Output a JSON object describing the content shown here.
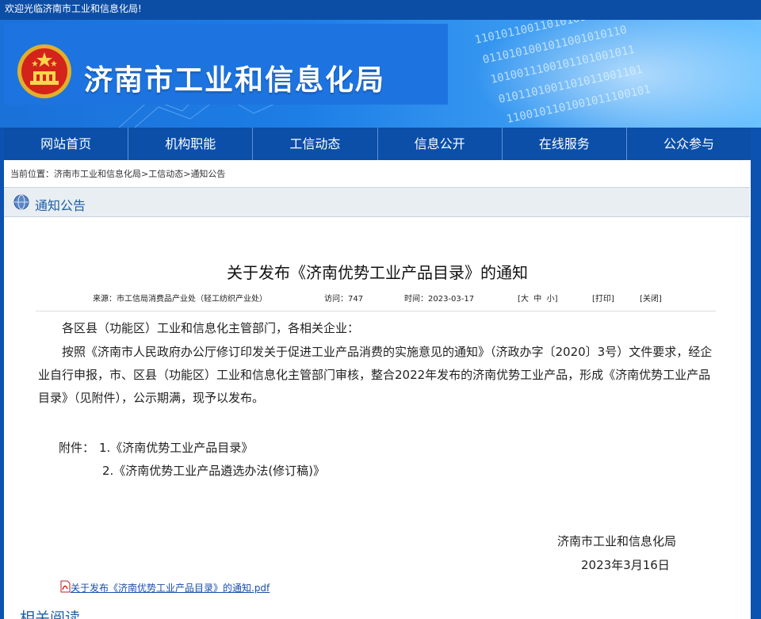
{
  "topbar": {
    "welcome": "欢迎光临济南市工业和信息化局!"
  },
  "header": {
    "site_title": "济南市工业和信息化局"
  },
  "nav": [
    {
      "label": "网站首页"
    },
    {
      "label": "机构职能"
    },
    {
      "label": "工信动态"
    },
    {
      "label": "信息公开"
    },
    {
      "label": "在线服务"
    },
    {
      "label": "公众参与"
    }
  ],
  "breadcrumb": {
    "prefix": "当前位置：",
    "items": [
      "济南市工业和信息化局",
      "工信动态",
      "通知公告"
    ],
    "separator": ">"
  },
  "section": {
    "title": "通知公告"
  },
  "article": {
    "title": "关于发布《济南优势工业产品目录》的通知",
    "meta": {
      "source": "来源：市工信局消费品产业处（轻工纺织产业处）",
      "visits": "访问：747",
      "date": "时间：2023-03-17",
      "font_size": "[大  中  小]",
      "print": "[打印]",
      "close": "[关闭]"
    },
    "greeting": "各区县（功能区）工业和信息化主管部门，各相关企业：",
    "body": "按照《济南市人民政府办公厅修订印发关于促进工业产品消费的实施意见的通知》（济政办字〔2020〕3号）文件要求，经企业自行申报，市、区县（功能区）工业和信息化主管部门审核，整合2022年发布的济南优势工业产品，形成《济南优势工业产品目录》（见附件），公示期满，现予以发布。",
    "attach_label": "附件：",
    "attachments": [
      "1.《济南优势工业产品目录》",
      "2.《济南优势工业产品遴选办法(修订稿)》"
    ],
    "signature": "济南市工业和信息化局",
    "sign_date": "2023年3月16日",
    "pdf_link": "关于发布《济南优势工业产品目录》的通知.pdf"
  },
  "related": {
    "title": "相关阅读"
  },
  "colors": {
    "nav_bg": "#0b4fa9",
    "banner_blue": "#1d74e0",
    "link": "#1a4ea8"
  }
}
